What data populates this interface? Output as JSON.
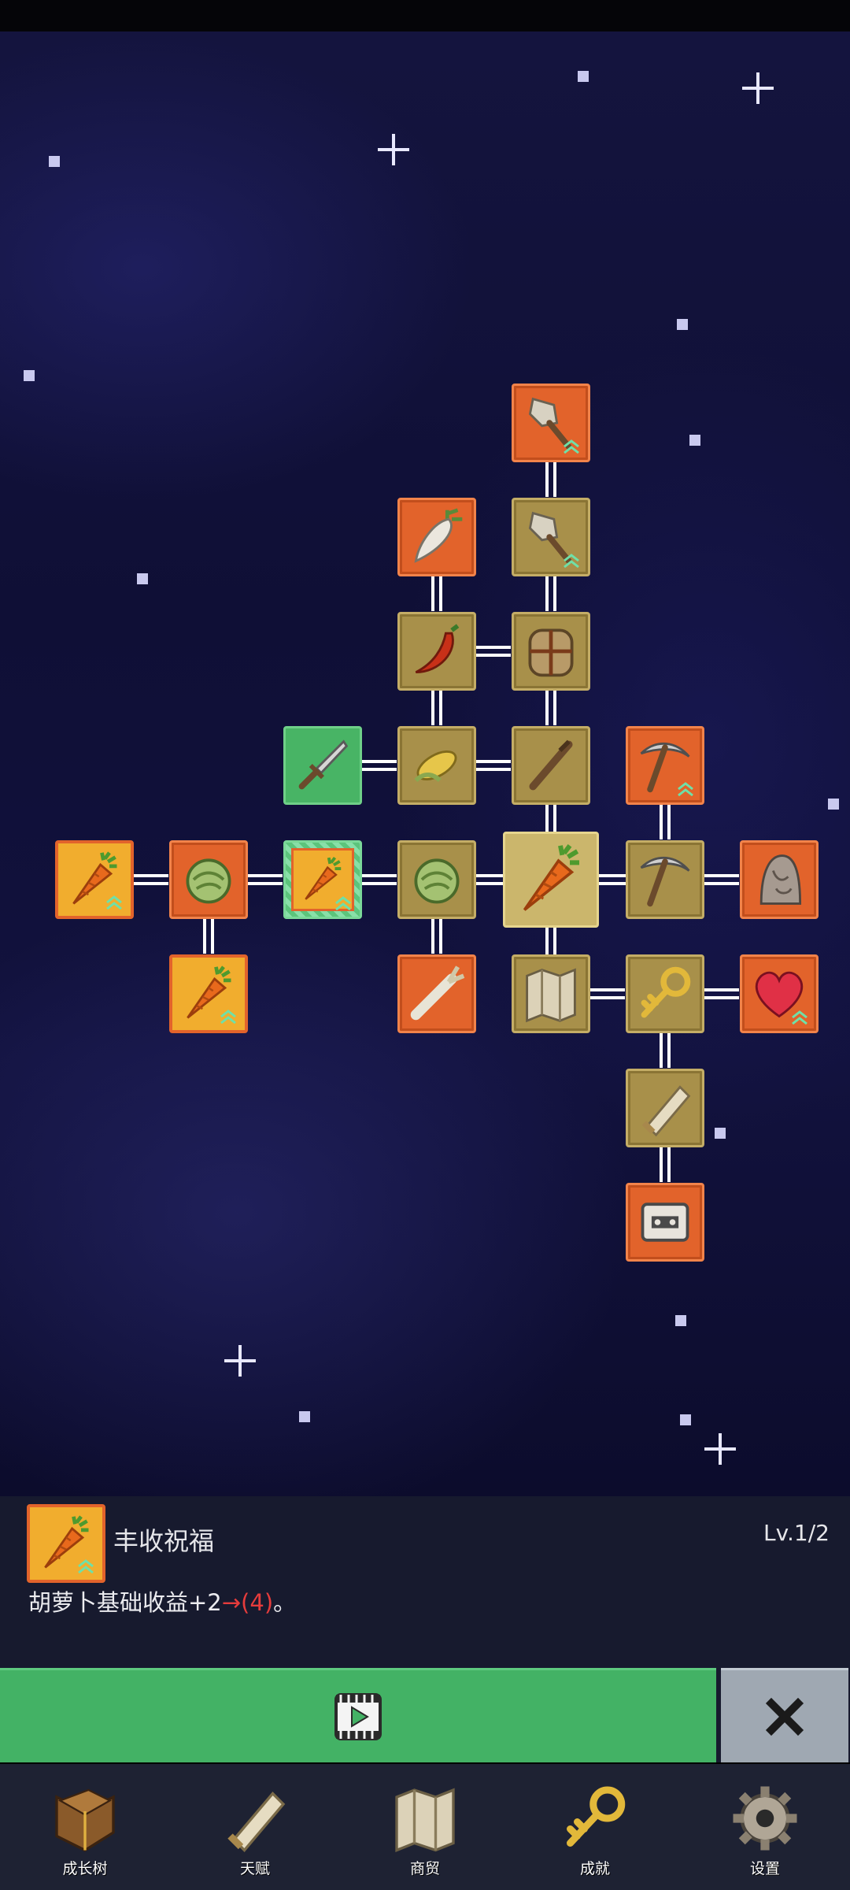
{
  "skill_tree": {
    "nodes": [
      {
        "id": "shovel-upgrade-2",
        "icon": "shovel-icon",
        "frame": "orange",
        "upgrade": true
      },
      {
        "id": "shovel-upgrade-1",
        "icon": "shovel-icon",
        "frame": "brown",
        "upgrade": true
      },
      {
        "id": "radish",
        "icon": "radish-icon",
        "frame": "orange",
        "upgrade": false
      },
      {
        "id": "chili",
        "icon": "chili-pepper-icon",
        "frame": "brown",
        "upgrade": false
      },
      {
        "id": "backpack",
        "icon": "backpack-icon",
        "frame": "brown",
        "upgrade": false
      },
      {
        "id": "sword",
        "icon": "sword-icon",
        "frame": "green",
        "upgrade": false
      },
      {
        "id": "corn",
        "icon": "corn-icon",
        "frame": "brown",
        "upgrade": false
      },
      {
        "id": "wooden-stick",
        "icon": "stick-icon",
        "frame": "brown",
        "upgrade": false
      },
      {
        "id": "pickaxe-upgrade",
        "icon": "pickaxe-icon",
        "frame": "orange",
        "upgrade": true
      },
      {
        "id": "carrot-blessing-outer",
        "icon": "carrot-icon",
        "frame": "gold",
        "upgrade": true
      },
      {
        "id": "cabbage-left",
        "icon": "cabbage-icon",
        "frame": "orange",
        "upgrade": false
      },
      {
        "id": "carrot-blessing-selected",
        "icon": "carrot-icon",
        "frame": "glow",
        "upgrade": true
      },
      {
        "id": "cabbage",
        "icon": "cabbage-icon",
        "frame": "brown",
        "upgrade": false
      },
      {
        "id": "carrot-root",
        "icon": "carrot-icon",
        "frame": "sel",
        "upgrade": false
      },
      {
        "id": "pickaxe",
        "icon": "pickaxe-icon",
        "frame": "brown",
        "upgrade": false
      },
      {
        "id": "ghost-statue",
        "icon": "ghost-statue-icon",
        "frame": "orange",
        "upgrade": false
      },
      {
        "id": "carrot-blessing-lower",
        "icon": "carrot-icon",
        "frame": "gold",
        "upgrade": true
      },
      {
        "id": "leek",
        "icon": "leek-icon",
        "frame": "orange",
        "upgrade": false
      },
      {
        "id": "map",
        "icon": "map-icon",
        "frame": "brown",
        "upgrade": false
      },
      {
        "id": "golden-key",
        "icon": "key-icon",
        "frame": "brown",
        "upgrade": false
      },
      {
        "id": "heart",
        "icon": "heart-icon",
        "frame": "orange",
        "upgrade": true
      },
      {
        "id": "scroll",
        "icon": "scroll-icon",
        "frame": "brown",
        "upgrade": false
      },
      {
        "id": "cassette",
        "icon": "cassette-icon",
        "frame": "orange",
        "upgrade": false
      }
    ]
  },
  "selected_skill": {
    "icon": "carrot-icon",
    "name": "丰收祝福",
    "level": "Lv.1/2",
    "desc_prefix": "胡萝卜基础收益+2",
    "desc_arrow": "→(4)",
    "desc_suffix": "。"
  },
  "actions": {
    "watch_ad_icon": "play-video-icon",
    "close_icon": "close-icon"
  },
  "bottom_nav": [
    {
      "label": "成长树",
      "icon": "book-icon"
    },
    {
      "label": "天赋",
      "icon": "scroll-icon"
    },
    {
      "label": "商贸",
      "icon": "map-icon"
    },
    {
      "label": "成就",
      "icon": "key-icon"
    },
    {
      "label": "设置",
      "icon": "gear-icon"
    }
  ],
  "colors": {
    "node_orange": "#e2632b",
    "node_brown": "#a8904a",
    "node_green": "#48b465",
    "action_green": "#43b265",
    "close_gray": "#9fa8b2",
    "panel_bg": "#171a2e"
  }
}
